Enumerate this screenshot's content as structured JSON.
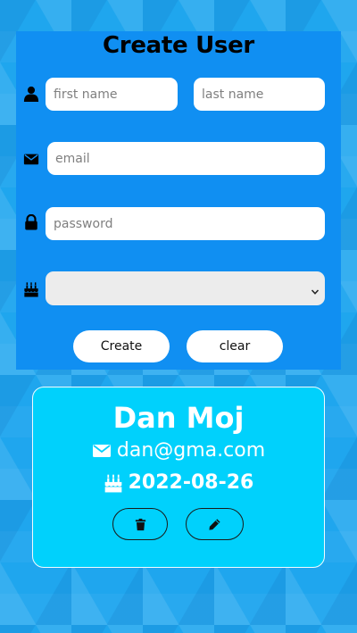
{
  "form": {
    "title": "Create User",
    "first_name_placeholder": "first name",
    "last_name_placeholder": "last name",
    "email_placeholder": "email",
    "password_placeholder": "password",
    "birthdate_value": "",
    "create_label": "Create",
    "clear_label": "clear"
  },
  "card": {
    "name": "Dan Moj",
    "email": "dan@gma.com",
    "date": "2022-08-26"
  },
  "icons": {
    "first_row": "user-icon",
    "email_row": "envelope-icon",
    "password_row": "lock-icon",
    "birthday_row": "cake-icon",
    "delete": "trash-icon",
    "edit": "pencil-icon"
  },
  "colors": {
    "background": "#1fa6ee",
    "form_panel": "#108ff2",
    "card": "#00d1fc"
  }
}
